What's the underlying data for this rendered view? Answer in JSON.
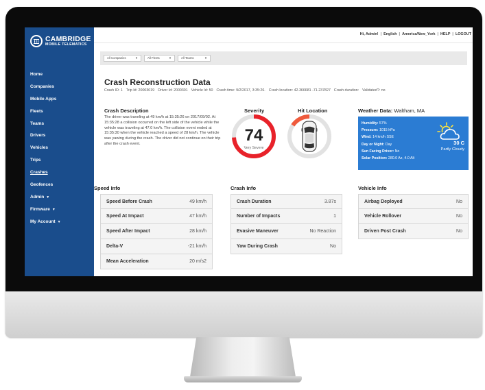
{
  "brand": {
    "line1": "CAMBRIDGE",
    "line2": "MOBILE TELEMATICS"
  },
  "sidebar": {
    "items": [
      {
        "label": "Home",
        "caret": false,
        "active": false
      },
      {
        "label": "Companies",
        "caret": false,
        "active": false
      },
      {
        "label": "Mobile Apps",
        "caret": false,
        "active": false
      },
      {
        "label": "Fleets",
        "caret": false,
        "active": false
      },
      {
        "label": "Teams",
        "caret": false,
        "active": false
      },
      {
        "label": "Drivers",
        "caret": false,
        "active": false
      },
      {
        "label": "Vehicles",
        "caret": false,
        "active": false
      },
      {
        "label": "Trips",
        "caret": false,
        "active": false
      },
      {
        "label": "Crashes",
        "caret": false,
        "active": true
      },
      {
        "label": "Geofences",
        "caret": false,
        "active": false
      },
      {
        "label": "Admin",
        "caret": true,
        "active": false
      },
      {
        "label": "Firmware",
        "caret": true,
        "active": false
      },
      {
        "label": "My Account",
        "caret": true,
        "active": false
      }
    ]
  },
  "topnav": {
    "greeting": "Hi, Admin!",
    "language": "English",
    "timezone": "America/New_York",
    "help": "HELP",
    "logout": "LOGOUT",
    "separator": "|"
  },
  "filters": [
    {
      "label": "All Companies"
    },
    {
      "label": "All Fleets"
    },
    {
      "label": "All Teams"
    }
  ],
  "page": {
    "title": "Crash Reconstruction Data",
    "meta": [
      "Crash ID: 1",
      "Trip Id: 20003019",
      "Driver Id: 2000301",
      "Vehicle Id: 50",
      "Crash time: 9/2/2017, 3:35:26.",
      "Crash location: 42.366681 -71.237827",
      "Crash duration:",
      "Validated?: no"
    ]
  },
  "description": {
    "title": "Crash Description",
    "body": "The driver was traveling at 49 km/h at 15:35:26 on 2017/09/02. At 15:35:28 a collision occurred on the left side of the vehicle while the vehicle was traveling at 47.0 km/h. The collision event ended at 15:35:30 when the vehicle reached a speed of 28 km/h. The vehicle was yawing during the crash. The driver did not continue on their trip after the crash event."
  },
  "severity": {
    "title": "Severity",
    "value": "74",
    "label": "Very Severe",
    "fraction": 0.74,
    "color": "#e8222a"
  },
  "hit_location": {
    "title": "Hit Location",
    "arc_color": "#ef5a3c"
  },
  "weather": {
    "title": "Weather Data:",
    "location": "Waltham, MA",
    "rows": [
      {
        "k": "Humidity:",
        "v": "57%"
      },
      {
        "k": "Pressure:",
        "v": "1015 hPa"
      },
      {
        "k": "Wind:",
        "v": "14 km/h SSE"
      },
      {
        "k": "Day or Night:",
        "v": "Day"
      },
      {
        "k": "Sun Facing Driver:",
        "v": "No"
      },
      {
        "k": "Solar Position:",
        "v": "280.0 Az, 4.0 Alt"
      }
    ],
    "temp": "30 C",
    "condition": "Partly Cloudy",
    "icon": "partly-cloudy-icon",
    "card_color": "#2b7cd3"
  },
  "speed_info": {
    "title": "Speed Info",
    "rows": [
      {
        "k": "Speed Before Crash",
        "v": "49 km/h"
      },
      {
        "k": "Speed At Impact",
        "v": "47 km/h"
      },
      {
        "k": "Speed After Impact",
        "v": "28 km/h"
      },
      {
        "k": "Delta-V",
        "v": "-21 km/h"
      },
      {
        "k": "Mean Acceleration",
        "v": "20 m/s2"
      }
    ]
  },
  "crash_info": {
    "title": "Crash Info",
    "rows": [
      {
        "k": "Crash Duration",
        "v": "3.87s"
      },
      {
        "k": "Number of Impacts",
        "v": "1"
      },
      {
        "k": "Evasive Maneuver",
        "v": "No Reaction"
      },
      {
        "k": "Yaw During Crash",
        "v": "No"
      }
    ]
  },
  "vehicle_info": {
    "title": "Vehicle Info",
    "rows": [
      {
        "k": "Airbag Deployed",
        "v": "No"
      },
      {
        "k": "Vehicle Rollover",
        "v": "No"
      },
      {
        "k": "Driven Post Crash",
        "v": "No"
      }
    ]
  }
}
